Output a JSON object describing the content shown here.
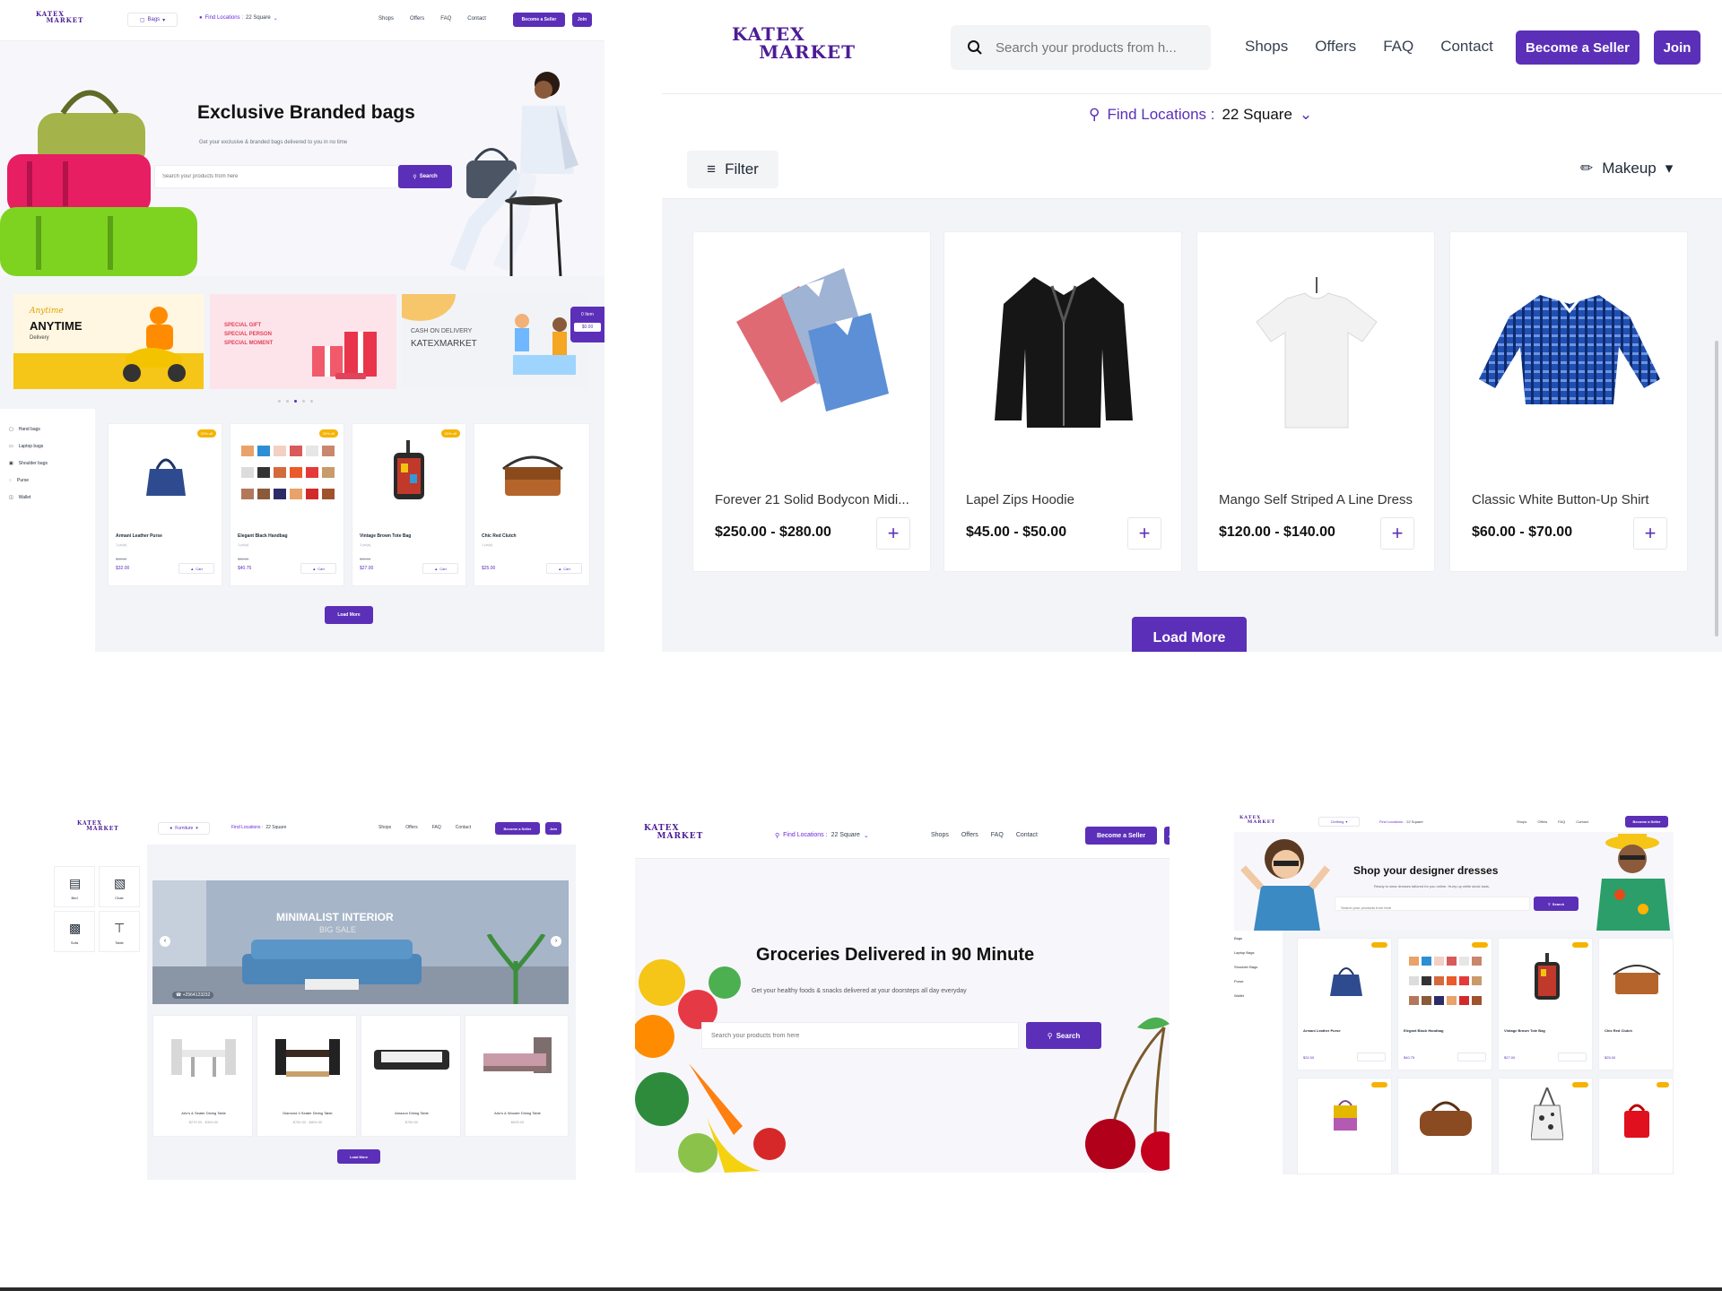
{
  "colors": {
    "brand": "#5b2fb8",
    "brand_light": "#7c3aed",
    "bg_grey": "#f3f4f8",
    "sale": "#f5b300"
  },
  "brand": {
    "logo_top": "KATEX",
    "logo_bottom": "MARKET"
  },
  "nav": {
    "shops": "Shops",
    "offers": "Offers",
    "faq": "FAQ",
    "contact": "Contact",
    "become_seller": "Become a Seller",
    "join": "Join"
  },
  "bags_page": {
    "category": "Bags",
    "location_label": "Find Locations :",
    "location_value": "22 Square",
    "hero_title": "Exclusive Branded bags",
    "hero_subtitle": "Get your exclusive & branded bags delivered to you in no time",
    "search_placeholder": "Search your products from here",
    "search_button": "Search",
    "promos": [
      {
        "line1": "Anytime",
        "line2": "ANYTIME",
        "line3": "Delivery"
      },
      {
        "line1": "SPECIAL GIFT",
        "line2": "SPECIAL PERSON",
        "line3": "SPECIAL MOMENT"
      },
      {
        "line1": "CASH ON DELIVERY",
        "line2": "KATEXMARKET"
      }
    ],
    "cart_widget": {
      "items": "0 Item",
      "amount": "$0.00"
    },
    "sidebar": [
      "Hand bags",
      "Laptop bags",
      "Shoulder bags",
      "Purse",
      "Wallet"
    ],
    "sale_badge": "30% off",
    "products": [
      {
        "name": "Armani Leather Purse",
        "unit": "1 pc(s)",
        "old": "$30.00",
        "price": "$32.00"
      },
      {
        "name": "Elegant Black Handbag",
        "unit": "1 pc(s)",
        "old": "$30.00",
        "price": "$40.75"
      },
      {
        "name": "Vintage Brown Tote Bag",
        "unit": "1 pc(s)",
        "old": "$30.00",
        "price": "$27.00"
      },
      {
        "name": "Chic Red Clutch",
        "unit": "1 pc(s)",
        "old": "",
        "price": "$25.00"
      }
    ],
    "cart_label": "Cart",
    "load_more": "Load More"
  },
  "clothing_page": {
    "search_placeholder": "Search your products from h...",
    "location_label": "Find Locations :",
    "location_value": "22 Square",
    "filter": "Filter",
    "category": "Makeup",
    "products": [
      {
        "name": "Forever 21 Solid Bodycon Midi...",
        "price": "$250.00 - $280.00"
      },
      {
        "name": "Lapel Zips Hoodie",
        "price": "$45.00 - $50.00"
      },
      {
        "name": "Mango Self Striped A Line Dress",
        "price": "$120.00 - $140.00"
      },
      {
        "name": "Classic White Button-Up Shirt",
        "price": "$60.00 - $70.00"
      }
    ],
    "load_more": "Load More"
  },
  "furniture_page": {
    "category": "Furniture",
    "location_label": "Find Locations :",
    "location_value": "22 Square",
    "categories": [
      "Bed",
      "Chair",
      "Sofa",
      "Table"
    ],
    "banner_title": "MINIMALIST INTERIOR",
    "banner_sub": "BIG SALE",
    "banner_phone": "+2564123232",
    "products": [
      {
        "name": "Arlo's & Seater Dining Table",
        "price": "$275.00 - $300.00"
      },
      {
        "name": "Diamond 4 Seater Dining Table",
        "price": "$750.00 - $800.00"
      },
      {
        "name": "Amazon Dining Table",
        "price": "$780.00"
      },
      {
        "name": "Arlo's & Wooder Dining Table",
        "price": "$695.00"
      }
    ],
    "load_more": "Load More"
  },
  "grocery_page": {
    "location_label": "Find Locations :",
    "location_value": "22 Square",
    "hero_title": "Groceries Delivered in 90 Minute",
    "hero_subtitle": "Get your healthy foods & snacks delivered at your doorsteps all day everyday",
    "search_placeholder": "Search your products from here",
    "search_button": "Search"
  },
  "dress_page": {
    "category": "Clothing",
    "location_label": "Find Locations :",
    "location_value": "22 Square",
    "hero_title": "Shop your designer dresses",
    "hero_subtitle": "Ready to wear dresses tailored for you online. Hurry up while stock lasts.",
    "search_placeholder": "Search your products from here",
    "search_button": "Search",
    "sidebar": [
      "Bags",
      "Laptop Bags",
      "Shoulder Bags",
      "Purse",
      "Wallet"
    ],
    "products": [
      {
        "name": "Armani Leather Purse",
        "price": "$32.00"
      },
      {
        "name": "Elegant Black Handbag",
        "price": "$40.75"
      },
      {
        "name": "Vintage Brown Tote Bag",
        "price": "$27.00"
      },
      {
        "name": "Chic Red Clutch",
        "price": "$25.00"
      }
    ]
  }
}
